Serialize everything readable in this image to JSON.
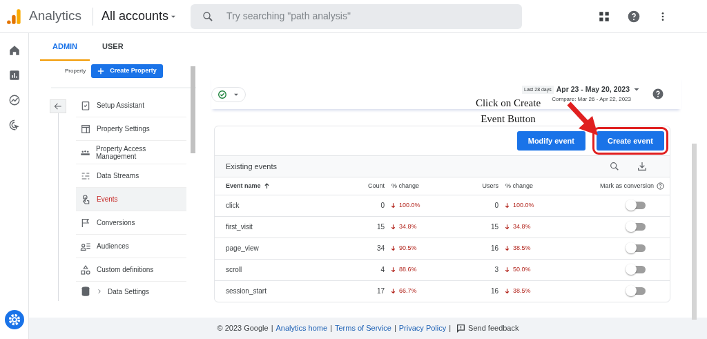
{
  "header": {
    "product": "Analytics",
    "account": "All accounts",
    "search": {
      "placeholder": "Try searching \"path analysis\""
    }
  },
  "tabs": [
    {
      "label": "ADMIN",
      "selected": true
    },
    {
      "label": "USER",
      "selected": false
    }
  ],
  "sidebar": {
    "property_label": "Property",
    "create_button": "Create Property",
    "items": [
      {
        "label": "Setup Assistant",
        "selected": false
      },
      {
        "label": "Property Settings",
        "selected": false
      },
      {
        "label": "Property Access Management",
        "selected": false
      },
      {
        "label": "Data Streams",
        "selected": false
      },
      {
        "label": "Events",
        "selected": true
      },
      {
        "label": "Conversions",
        "selected": false
      },
      {
        "label": "Audiences",
        "selected": false
      },
      {
        "label": "Custom definitions",
        "selected": false
      },
      {
        "label": "Data Settings",
        "selected": false
      }
    ]
  },
  "date_range": {
    "preset": "Last 28 days",
    "range": "Apr 23 - May 20, 2023",
    "compare": "Compare: Mar 26 - Apr 22, 2023"
  },
  "annotation": {
    "text": "Click on Create Event Button"
  },
  "buttons": [
    {
      "label": "Modify event",
      "highlighted": false
    },
    {
      "label": "Create event",
      "highlighted": true
    }
  ],
  "table": {
    "title": "Existing events",
    "columns": [
      "Event name",
      "Count",
      "% change",
      "Users",
      "% change",
      "Mark as conversion"
    ],
    "rows": [
      {
        "name": "click",
        "count": "0",
        "count_change": "100.0%",
        "users": "0",
        "users_change": "100.0%",
        "conversion": false
      },
      {
        "name": "first_visit",
        "count": "15",
        "count_change": "34.8%",
        "users": "15",
        "users_change": "34.8%",
        "conversion": false
      },
      {
        "name": "page_view",
        "count": "34",
        "count_change": "90.5%",
        "users": "16",
        "users_change": "38.5%",
        "conversion": false
      },
      {
        "name": "scroll",
        "count": "4",
        "count_change": "88.6%",
        "users": "3",
        "users_change": "50.0%",
        "conversion": false
      },
      {
        "name": "session_start",
        "count": "17",
        "count_change": "66.7%",
        "users": "16",
        "users_change": "38.5%",
        "conversion": false
      }
    ]
  },
  "footer": {
    "copyright": "© 2023 Google",
    "separator": "|",
    "links": [
      "Analytics home",
      "Terms of Service",
      "Privacy Policy"
    ],
    "feedback": "Send feedback"
  }
}
